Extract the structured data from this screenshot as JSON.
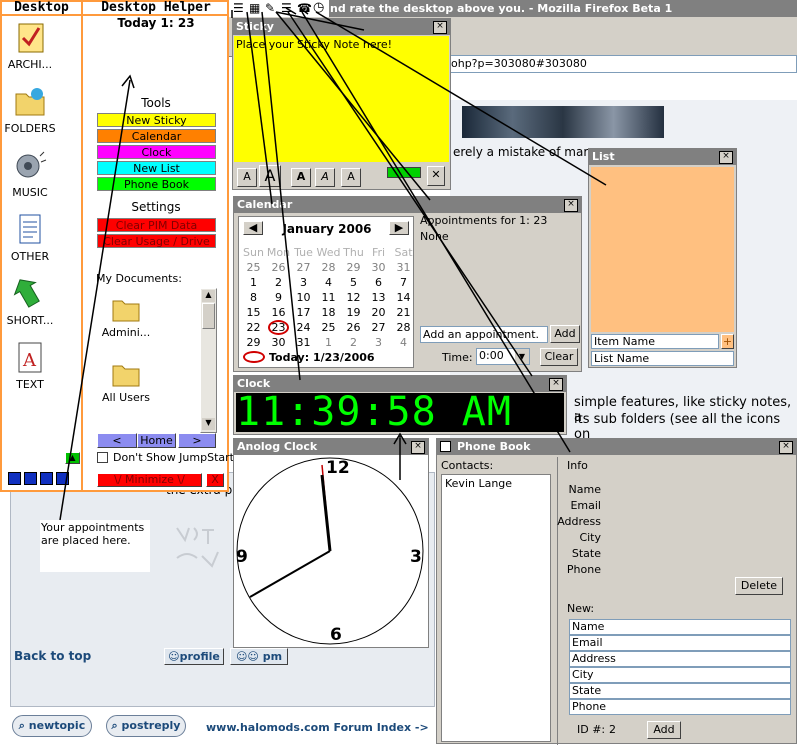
{
  "firefox": {
    "title": "nd rate the desktop above you. - Mozilla Firefox Beta 1",
    "url": "ohp?p=303080#303080",
    "post_text_1": "erely a mistake of mar",
    "post_text_2": "simple features, like sticky notes, a",
    "post_text_3": "its sub folders (see all the icons on",
    "post_text_4": "the extra p",
    "back_to_top": "Back to top",
    "profile": "profile",
    "pm": "pm",
    "newtopic": "newtopic",
    "postreply": "postreply",
    "forum_index": "www.halomods.com Forum Index ->",
    "appt_note": "Your appointments are placed here."
  },
  "desktop": {
    "header": "Desktop",
    "items": [
      {
        "label": "ARCHI...",
        "icon": "notepad-icon"
      },
      {
        "label": "FOLDERS",
        "icon": "folder-icon"
      },
      {
        "label": "MUSIC",
        "icon": "speaker-icon"
      },
      {
        "label": "OTHER",
        "icon": "document-icon"
      },
      {
        "label": "SHORT...",
        "icon": "arrow-icon"
      },
      {
        "label": "TEXT",
        "icon": "text-file-icon"
      }
    ]
  },
  "helper": {
    "header": "Desktop Helper",
    "today": "Today 1: 23",
    "tools_label": "Tools",
    "tools": [
      {
        "label": "New Sticky",
        "bg": "#ffff00",
        "fg": "#000000"
      },
      {
        "label": "Calendar",
        "bg": "#ff8000",
        "fg": "#000000"
      },
      {
        "label": "Clock",
        "bg": "#ff00ff",
        "fg": "#000000"
      },
      {
        "label": "New List",
        "bg": "#00ffff",
        "fg": "#000000"
      },
      {
        "label": "Phone Book",
        "bg": "#00ff00",
        "fg": "#000000"
      }
    ],
    "settings_label": "Settings",
    "settings": [
      {
        "label": "Clear PIM Data",
        "bg": "#ff0000",
        "fg": "#800000"
      },
      {
        "label": "Clear Usage / Drive",
        "bg": "#ff0000",
        "fg": "#800000"
      }
    ],
    "mydocs_label": "My Documents:",
    "docs": [
      {
        "label": "Admini..."
      },
      {
        "label": "All Users"
      }
    ],
    "nav_prev": "<",
    "nav_home": "Home",
    "nav_next": ">",
    "dont_show": "Don't Show JumpStart",
    "minimize": "\\/ Minimize \\/",
    "close": "X"
  },
  "sticky": {
    "title": "Sticky",
    "placeholder": "Place your Sticky Note here!",
    "font_buttons": [
      "A",
      "A",
      "A",
      "A",
      "A"
    ]
  },
  "list": {
    "title": "List",
    "item_name_input": "Item Name",
    "add": "+",
    "column_header": "List Name"
  },
  "calendar": {
    "title": "Calendar",
    "month": "January 2006",
    "weekdays": [
      "Sun",
      "Mon",
      "Tue",
      "Wed",
      "Thu",
      "Fri",
      "Sat"
    ],
    "weeks": [
      [
        "25",
        "26",
        "27",
        "28",
        "29",
        "30",
        "31"
      ],
      [
        "1",
        "2",
        "3",
        "4",
        "5",
        "6",
        "7"
      ],
      [
        "8",
        "9",
        "10",
        "11",
        "12",
        "13",
        "14"
      ],
      [
        "15",
        "16",
        "17",
        "18",
        "19",
        "20",
        "21"
      ],
      [
        "22",
        "23",
        "24",
        "25",
        "26",
        "27",
        "28"
      ],
      [
        "29",
        "30",
        "31",
        "1",
        "2",
        "3",
        "4"
      ]
    ],
    "today_label": "Today: 1/23/2006",
    "appointments_for": "Appointments for  1: 23",
    "appointments_value": "None",
    "add_appt_placeholder": "Add an appointment.",
    "add_button": "Add",
    "time_label": "Time:",
    "time_value": "0:00",
    "clear_button": "Clear"
  },
  "clock": {
    "title": "Clock",
    "digital": "11:39:58 AM",
    "digital_color": "#00ff00"
  },
  "analog": {
    "title": "Anolog Clock",
    "n12": "12",
    "n3": "3",
    "n6": "6",
    "n9": "9"
  },
  "phonebook": {
    "title": "Phone Book",
    "contacts_label": "Contacts:",
    "contacts": [
      "Kevin Lange"
    ],
    "info_label": "Info",
    "fields": [
      "Name",
      "Email",
      "Address",
      "City",
      "State",
      "Phone"
    ],
    "delete_button": "Delete",
    "new_label": "New:",
    "new_fields": [
      "Name",
      "Email",
      "Address",
      "City",
      "State",
      "Phone"
    ],
    "id_label": "ID #:",
    "id_value": "2",
    "add_button": "Add"
  }
}
